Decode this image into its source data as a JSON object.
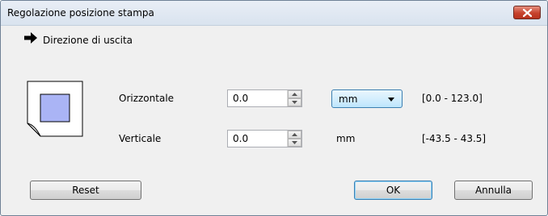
{
  "window": {
    "title": "Regolazione posizione stampa"
  },
  "direction": {
    "label": "Direzione di uscita",
    "icon": "right-arrow-icon"
  },
  "horizontal": {
    "label": "Orizzontale",
    "value": "0.0",
    "unit": "mm",
    "range": "[0.0 - 123.0]"
  },
  "vertical": {
    "label": "Verticale",
    "value": "0.0",
    "unit": "mm",
    "range": "[-43.5 - 43.5]"
  },
  "buttons": {
    "reset": "Reset",
    "ok": "OK",
    "cancel": "Annulla"
  },
  "colors": {
    "close_button": "#c6422c",
    "paper_fill": "#aab4f5",
    "focus_border": "#3c7fb1"
  }
}
